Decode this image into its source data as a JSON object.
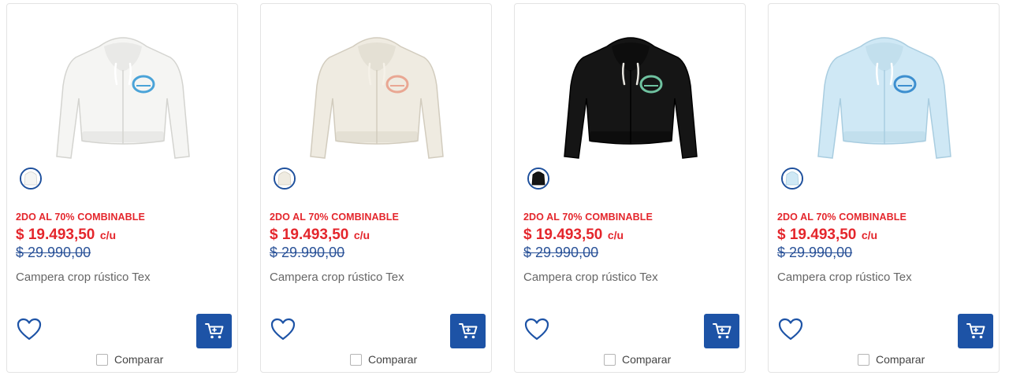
{
  "products": [
    {
      "promo": "2DO AL 70% COMBINABLE",
      "price": "$ 19.493,50",
      "unit": "c/u",
      "old_price": "$ 29.990,00",
      "name": "Campera crop rústico Tex",
      "compare_label": "Comparar",
      "colors": {
        "body": "#f5f5f3",
        "outline": "#d4d4d0",
        "logo": "#4aa3d8",
        "strings": "#ffffff"
      }
    },
    {
      "promo": "2DO AL 70% COMBINABLE",
      "price": "$ 19.493,50",
      "unit": "c/u",
      "old_price": "$ 29.990,00",
      "name": "Campera crop rústico Tex",
      "compare_label": "Comparar",
      "colors": {
        "body": "#efebe1",
        "outline": "#d2ccbe",
        "logo": "#e9a793",
        "strings": "#f5f1e8"
      }
    },
    {
      "promo": "2DO AL 70% COMBINABLE",
      "price": "$ 19.493,50",
      "unit": "c/u",
      "old_price": "$ 29.990,00",
      "name": "Campera crop rústico Tex",
      "compare_label": "Comparar",
      "colors": {
        "body": "#151515",
        "outline": "#000000",
        "logo": "#6fc2a0",
        "strings": "#e8e6e0"
      }
    },
    {
      "promo": "2DO AL 70% COMBINABLE",
      "price": "$ 19.493,50",
      "unit": "c/u",
      "old_price": "$ 29.990,00",
      "name": "Campera crop rústico Tex",
      "compare_label": "Comparar",
      "colors": {
        "body": "#cfe8f5",
        "outline": "#a9cde0",
        "logo": "#3d8fcf",
        "strings": "#ffffff"
      }
    }
  ],
  "theme": {
    "promo_color": "#e4262c",
    "old_price_color": "#2a5298",
    "cart_button_color": "#1d53a6"
  },
  "icons": {
    "favorite": "heart-outline-icon",
    "cart": "cart-icon"
  }
}
